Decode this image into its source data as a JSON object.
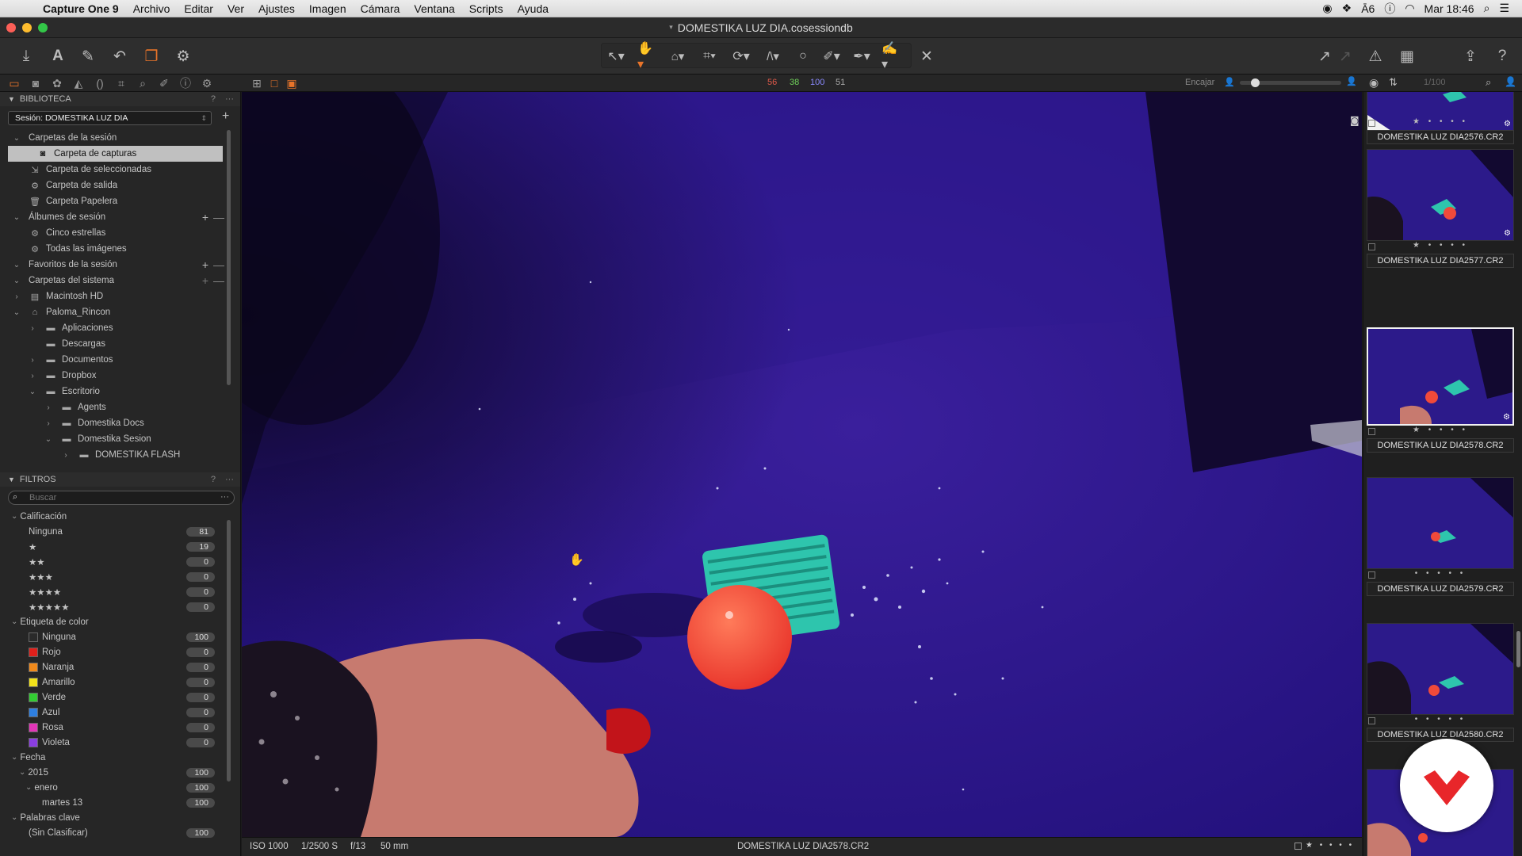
{
  "menubar": {
    "app_name": "Capture One 9",
    "items": [
      "Archivo",
      "Editar",
      "Ver",
      "Ajustes",
      "Imagen",
      "Cámara",
      "Ventana",
      "Scripts",
      "Ayuda"
    ],
    "status_battery_count": "6",
    "clock": "Mar 18:46"
  },
  "window": {
    "title": "DOMESTIKA LUZ DIA.cosessiondb"
  },
  "secbar": {
    "rgb": {
      "r": "56",
      "g": "38",
      "b": "100",
      "a": "51"
    },
    "fit_label": "Encajar",
    "page_counter": "1/100"
  },
  "library": {
    "header": "BIBLIOTECA",
    "help": "?",
    "more": "···",
    "session_select": "Sesión: DOMESTIKA LUZ DIA",
    "session_folders_label": "Carpetas de la sesión",
    "session_folders": [
      "Carpeta de capturas",
      "Carpeta de seleccionadas",
      "Carpeta de salida",
      "Carpeta Papelera"
    ],
    "albums_label": "Álbumes de sesión",
    "albums": [
      "Cinco estrellas",
      "Todas las imágenes"
    ],
    "favorites_label": "Favoritos de la sesión",
    "system_label": "Carpetas del sistema",
    "tree": [
      {
        "label": "Macintosh HD",
        "depth": 0,
        "open": false
      },
      {
        "label": "Paloma_Rincon",
        "depth": 0,
        "open": true
      },
      {
        "label": "Aplicaciones",
        "depth": 1,
        "open": false
      },
      {
        "label": "Descargas",
        "depth": 1,
        "open": null
      },
      {
        "label": "Documentos",
        "depth": 1,
        "open": false
      },
      {
        "label": "Dropbox",
        "depth": 1,
        "open": false
      },
      {
        "label": "Escritorio",
        "depth": 1,
        "open": true
      },
      {
        "label": "Agents",
        "depth": 2,
        "open": false
      },
      {
        "label": "Domestika Docs",
        "depth": 2,
        "open": false
      },
      {
        "label": "Domestika Sesion",
        "depth": 2,
        "open": true
      },
      {
        "label": "DOMESTIKA FLASH",
        "depth": 3,
        "open": false
      }
    ]
  },
  "filters": {
    "header": "FILTROS",
    "search_placeholder": "Buscar",
    "rating_label": "Calificación",
    "ratings": [
      {
        "label": "Ninguna",
        "count": "81"
      },
      {
        "label": "★",
        "count": "19"
      },
      {
        "label": "★★",
        "count": "0"
      },
      {
        "label": "★★★",
        "count": "0"
      },
      {
        "label": "★★★★",
        "count": "0"
      },
      {
        "label": "★★★★★",
        "count": "0"
      }
    ],
    "color_label": "Etiqueta de color",
    "colors": [
      {
        "label": "Ninguna",
        "count": "100",
        "hex": "#2a2a2a"
      },
      {
        "label": "Rojo",
        "count": "0",
        "hex": "#e0201b"
      },
      {
        "label": "Naranja",
        "count": "0",
        "hex": "#f08a1c"
      },
      {
        "label": "Amarillo",
        "count": "0",
        "hex": "#f2e21a"
      },
      {
        "label": "Verde",
        "count": "0",
        "hex": "#33cc33"
      },
      {
        "label": "Azul",
        "count": "0",
        "hex": "#2e7fe0"
      },
      {
        "label": "Rosa",
        "count": "0",
        "hex": "#e236b8"
      },
      {
        "label": "Violeta",
        "count": "0",
        "hex": "#8a3ee0"
      }
    ],
    "date_label": "Fecha",
    "dates": [
      {
        "label": "2015",
        "count": "100",
        "depth": 1
      },
      {
        "label": "enero",
        "count": "100",
        "depth": 2
      },
      {
        "label": "martes 13",
        "count": "100",
        "depth": 3
      }
    ],
    "keywords_label": "Palabras clave",
    "keywords": [
      {
        "label": "(Sin Clasificar)",
        "count": "100"
      }
    ]
  },
  "viewer": {
    "iso": "ISO 1000",
    "shutter": "1/2500 S",
    "aperture": "f/13",
    "focal": "50 mm",
    "filename": "DOMESTIKA LUZ DIA2578.CR2"
  },
  "browser": {
    "thumbs": [
      {
        "name": "DOMESTIKA LUZ DIA2576.CR2",
        "stars": "★ • • • •"
      },
      {
        "name": "DOMESTIKA LUZ DIA2577.CR2",
        "stars": "★ • • • •"
      },
      {
        "name": "DOMESTIKA LUZ DIA2578.CR2",
        "stars": "★ • • • •"
      },
      {
        "name": "DOMESTIKA LUZ DIA2579.CR2",
        "stars": "• • • • •"
      },
      {
        "name": "DOMESTIKA LUZ DIA2580.CR2",
        "stars": "• • • • •"
      }
    ]
  },
  "colors": {
    "accent_orange": "#e8742a",
    "red_channel": "#e05a4a",
    "green_channel": "#6fcf5a",
    "blue_channel": "#8a8aff"
  }
}
